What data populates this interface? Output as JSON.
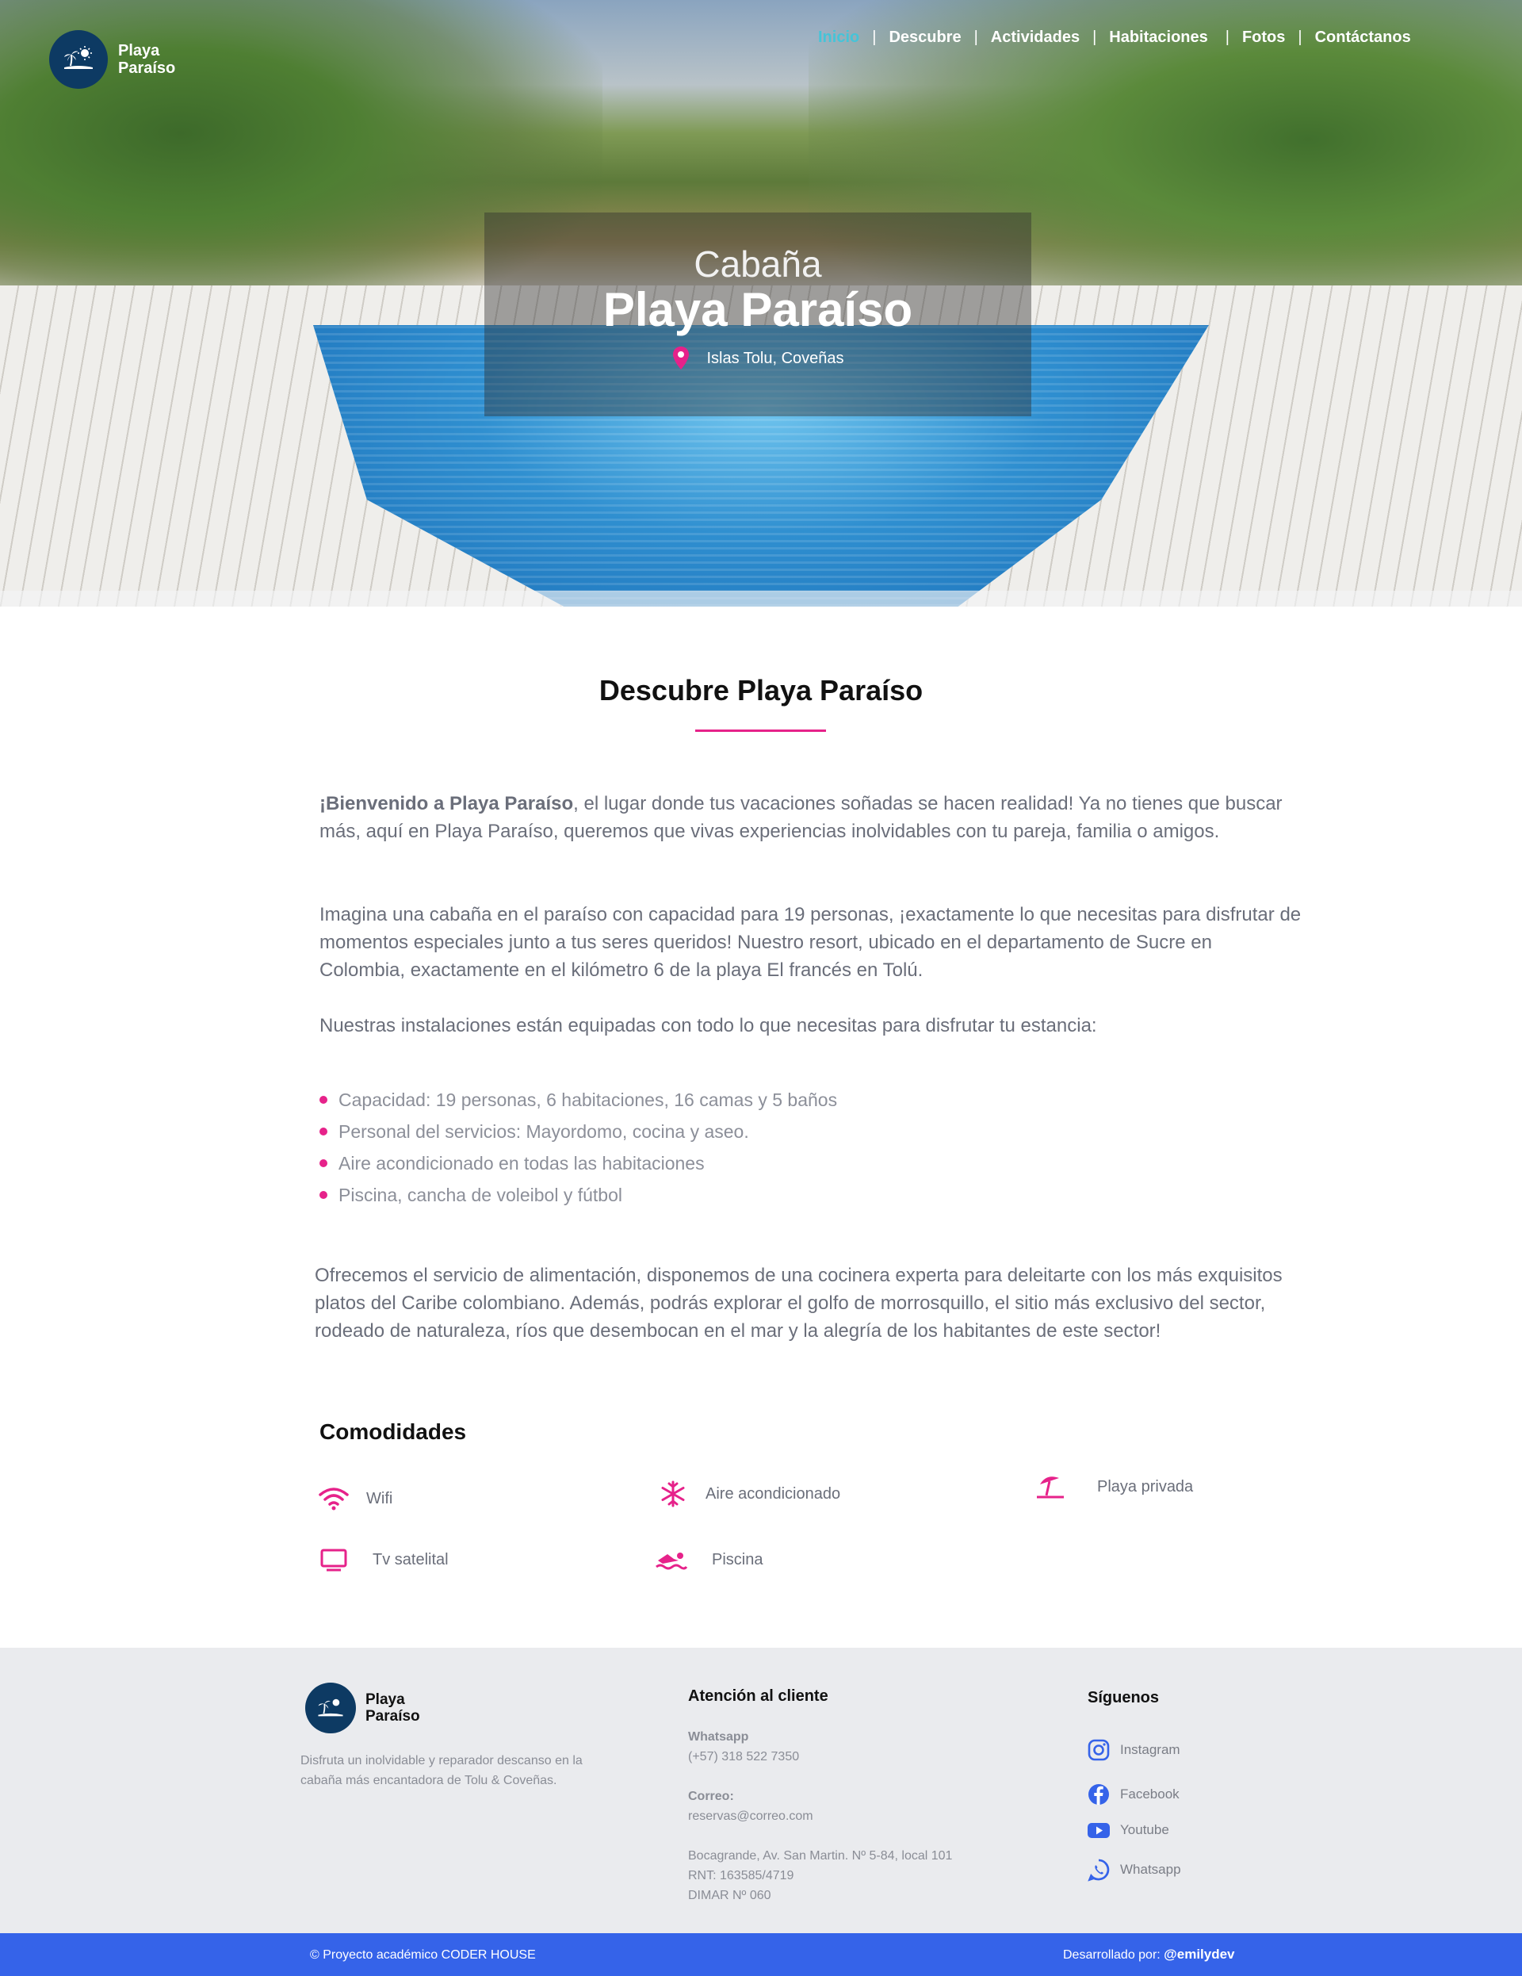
{
  "brand": {
    "line1": "Playa",
    "line2": "Paraíso"
  },
  "nav": {
    "items": [
      "Inicio",
      "Descubre",
      "Actividades",
      "Habitaciones",
      "Fotos",
      "Contáctanos"
    ],
    "separator": "|",
    "active_color": "#45c4d8"
  },
  "hero": {
    "subtitle": "Cabaña",
    "title": "Playa Paraíso",
    "location": "Islas Tolu, Coveñas",
    "location_icon": "map-pin-icon"
  },
  "main": {
    "title": "Descubre Playa Paraíso",
    "intro_bold": "¡Bienvenido a Playa Paraíso",
    "intro_rest": ", el lugar donde tus vacaciones soñadas se hacen realidad! Ya no tienes que buscar más, aquí en Playa Paraíso, queremos que vivas experiencias inolvidables con tu pareja, familia o amigos.",
    "para2": "Imagina una cabaña en el paraíso con capacidad para 19 personas, ¡exactamente lo que necesitas para disfrutar de momentos especiales junto a tus seres queridos! Nuestro resort, ubicado en el departamento de Sucre en Colombia, exactamente en el kilómetro 6 de la playa El francés en Tolú.",
    "para3": "Nuestras instalaciones están equipadas con todo lo que necesitas para disfrutar tu estancia:",
    "features": [
      "Capacidad: 19 personas, 6 habitaciones, 16 camas y 5 baños",
      "Personal del servicios: Mayordomo, cocina y aseo.",
      "Aire acondicionado en todas las habitaciones",
      "Piscina, cancha de voleibol y fútbol"
    ],
    "para4": "Ofrecemos el servicio de alimentación, disponemos de una cocinera experta para deleitarte con los más exquisitos platos del Caribe colombiano. Además, podrás explorar el golfo de morrosquillo, el sitio más exclusivo del sector, rodeado de naturaleza, ríos que desembocan en el mar y la alegría de los habitantes de este sector!",
    "amenities_title": "Comodidades",
    "amenities": [
      {
        "label": "Wifi",
        "icon": "wifi-icon"
      },
      {
        "label": "Aire acondicionado",
        "icon": "snowflake-icon"
      },
      {
        "label": "Playa privada",
        "icon": "beach-umbrella-icon"
      },
      {
        "label": "Tv satelital",
        "icon": "tv-icon"
      },
      {
        "label": "Piscina",
        "icon": "swimmer-icon"
      }
    ],
    "accent_color": "#e6228a"
  },
  "footer": {
    "description": "Disfruta un inolvidable y reparador descanso en la cabaña más encantadora de Tolu & Coveñas.",
    "contact_title": "Atención al cliente",
    "whatsapp_label": "Whatsapp",
    "whatsapp_value": "(+57) 318 522 7350",
    "email_label": "Correo:",
    "email_value": "reservas@correo.com",
    "address1": "Bocagrande, Av. San Martin. Nº 5-84, local 101",
    "address2": "RNT: 163585/4719",
    "address3": "DIMAR Nº 060",
    "follow_title": "Síguenos",
    "socials": [
      {
        "label": "Instagram",
        "icon": "instagram-icon"
      },
      {
        "label": "Facebook",
        "icon": "facebook-icon"
      },
      {
        "label": "Youtube",
        "icon": "youtube-icon"
      },
      {
        "label": "Whatsapp",
        "icon": "whatsapp-icon"
      }
    ]
  },
  "bottom_bar": {
    "left": "© Proyecto académico CODER HOUSE",
    "right_prefix": "Desarrollado por: ",
    "right_handle": "@emilydev",
    "color": "#3563e9"
  }
}
